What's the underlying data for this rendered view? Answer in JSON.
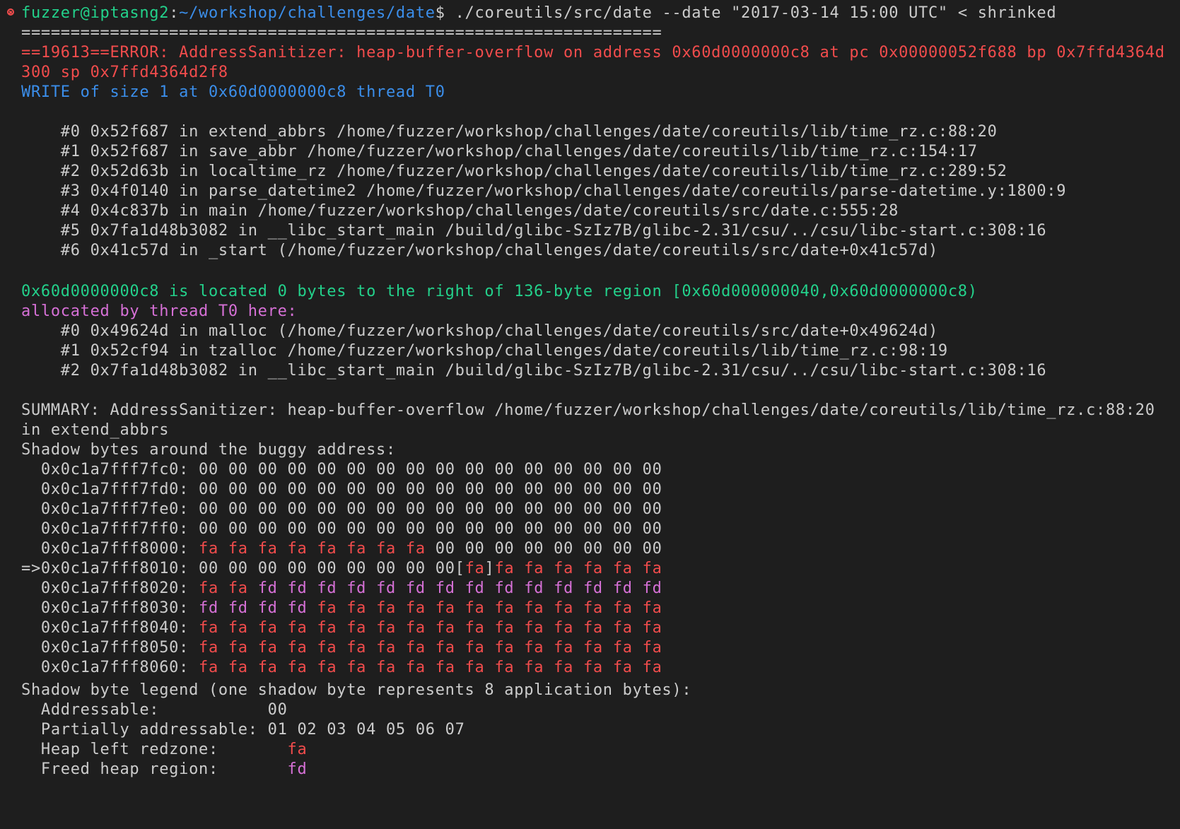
{
  "terminal": {
    "prompt_user_host": "fuzzer@iptasng2",
    "prompt_sep": ":",
    "prompt_path": "~/workshop/challenges/date",
    "prompt_dollar": "$",
    "command": " ./coreutils/src/date --date \"2017-03-14 15:00 UTC\" < shrinked",
    "separator": "=================================================================",
    "error_line_1": "==19613==ERROR: AddressSanitizer: heap-buffer-overflow on address 0x60d0000000c8 at pc 0x00000052f688 bp 0x7ffd4364d",
    "error_line_2": "300 sp 0x7ffd4364d2f8",
    "write_line": "WRITE of size 1 at 0x60d0000000c8 thread T0",
    "frames": [
      "    #0 0x52f687 in extend_abbrs /home/fuzzer/workshop/challenges/date/coreutils/lib/time_rz.c:88:20",
      "    #1 0x52f687 in save_abbr /home/fuzzer/workshop/challenges/date/coreutils/lib/time_rz.c:154:17",
      "    #2 0x52d63b in localtime_rz /home/fuzzer/workshop/challenges/date/coreutils/lib/time_rz.c:289:52",
      "    #3 0x4f0140 in parse_datetime2 /home/fuzzer/workshop/challenges/date/coreutils/parse-datetime.y:1800:9",
      "    #4 0x4c837b in main /home/fuzzer/workshop/challenges/date/coreutils/src/date.c:555:28",
      "    #5 0x7fa1d48b3082 in __libc_start_main /build/glibc-SzIz7B/glibc-2.31/csu/../csu/libc-start.c:308:16",
      "    #6 0x41c57d in _start (/home/fuzzer/workshop/challenges/date/coreutils/src/date+0x41c57d)"
    ],
    "located_line": "0x60d0000000c8 is located 0 bytes to the right of 136-byte region [0x60d000000040,0x60d0000000c8)",
    "allocated_line": "allocated by thread T0 here:",
    "alloc_frames": [
      "    #0 0x49624d in malloc (/home/fuzzer/workshop/challenges/date/coreutils/src/date+0x49624d)",
      "    #1 0x52cf94 in tzalloc /home/fuzzer/workshop/challenges/date/coreutils/lib/time_rz.c:98:19",
      "    #2 0x7fa1d48b3082 in __libc_start_main /build/glibc-SzIz7B/glibc-2.31/csu/../csu/libc-start.c:308:16"
    ],
    "summary_line_1": "SUMMARY: AddressSanitizer: heap-buffer-overflow /home/fuzzer/workshop/challenges/date/coreutils/lib/time_rz.c:88:20",
    "summary_line_2": "in extend_abbrs",
    "shadow_header": "Shadow bytes around the buggy address:",
    "shadow_rows": [
      {
        "prefix": "  0x0c1a7fff7fc0: ",
        "bytes": [
          "00",
          "00",
          "00",
          "00",
          "00",
          "00",
          "00",
          "00",
          "00",
          "00",
          "00",
          "00",
          "00",
          "00",
          "00",
          "00"
        ],
        "mark": -1
      },
      {
        "prefix": "  0x0c1a7fff7fd0: ",
        "bytes": [
          "00",
          "00",
          "00",
          "00",
          "00",
          "00",
          "00",
          "00",
          "00",
          "00",
          "00",
          "00",
          "00",
          "00",
          "00",
          "00"
        ],
        "mark": -1
      },
      {
        "prefix": "  0x0c1a7fff7fe0: ",
        "bytes": [
          "00",
          "00",
          "00",
          "00",
          "00",
          "00",
          "00",
          "00",
          "00",
          "00",
          "00",
          "00",
          "00",
          "00",
          "00",
          "00"
        ],
        "mark": -1
      },
      {
        "prefix": "  0x0c1a7fff7ff0: ",
        "bytes": [
          "00",
          "00",
          "00",
          "00",
          "00",
          "00",
          "00",
          "00",
          "00",
          "00",
          "00",
          "00",
          "00",
          "00",
          "00",
          "00"
        ],
        "mark": -1
      },
      {
        "prefix": "  0x0c1a7fff8000: ",
        "bytes": [
          "fa",
          "fa",
          "fa",
          "fa",
          "fa",
          "fa",
          "fa",
          "fa",
          "00",
          "00",
          "00",
          "00",
          "00",
          "00",
          "00",
          "00"
        ],
        "mark": -1
      },
      {
        "prefix": "=>0x0c1a7fff8010: ",
        "bytes": [
          "00",
          "00",
          "00",
          "00",
          "00",
          "00",
          "00",
          "00",
          "00",
          "fa",
          "fa",
          "fa",
          "fa",
          "fa",
          "fa",
          "fa"
        ],
        "mark": 9
      },
      {
        "prefix": "  0x0c1a7fff8020: ",
        "bytes": [
          "fa",
          "fa",
          "fd",
          "fd",
          "fd",
          "fd",
          "fd",
          "fd",
          "fd",
          "fd",
          "fd",
          "fd",
          "fd",
          "fd",
          "fd",
          "fd"
        ],
        "mark": -1
      },
      {
        "prefix": "  0x0c1a7fff8030: ",
        "bytes": [
          "fd",
          "fd",
          "fd",
          "fd",
          "fa",
          "fa",
          "fa",
          "fa",
          "fa",
          "fa",
          "fa",
          "fa",
          "fa",
          "fa",
          "fa",
          "fa"
        ],
        "mark": -1
      },
      {
        "prefix": "  0x0c1a7fff8040: ",
        "bytes": [
          "fa",
          "fa",
          "fa",
          "fa",
          "fa",
          "fa",
          "fa",
          "fa",
          "fa",
          "fa",
          "fa",
          "fa",
          "fa",
          "fa",
          "fa",
          "fa"
        ],
        "mark": -1
      },
      {
        "prefix": "  0x0c1a7fff8050: ",
        "bytes": [
          "fa",
          "fa",
          "fa",
          "fa",
          "fa",
          "fa",
          "fa",
          "fa",
          "fa",
          "fa",
          "fa",
          "fa",
          "fa",
          "fa",
          "fa",
          "fa"
        ],
        "mark": -1
      },
      {
        "prefix": "  0x0c1a7fff8060: ",
        "bytes": [
          "fa",
          "fa",
          "fa",
          "fa",
          "fa",
          "fa",
          "fa",
          "fa",
          "fa",
          "fa",
          "fa",
          "fa",
          "fa",
          "fa",
          "fa",
          "fa"
        ],
        "mark": -1
      }
    ],
    "legend_header": "Shadow byte legend (one shadow byte represents 8 application bytes):",
    "legend": [
      {
        "label": "  Addressable:           ",
        "value": "00"
      },
      {
        "label": "  Partially addressable: ",
        "value": "01 02 03 04 05 06 07"
      },
      {
        "label": "  Heap left redzone:       ",
        "value": "fa"
      },
      {
        "label": "  Freed heap region:       ",
        "value": "fd"
      }
    ],
    "colors": {
      "background": "#1e1e1e",
      "foreground": "#cccccc",
      "green": "#23d18b",
      "blue": "#3b8eea",
      "red": "#f14c4c",
      "magenta": "#d670d6"
    },
    "status_icon": "error-circle-icon"
  }
}
